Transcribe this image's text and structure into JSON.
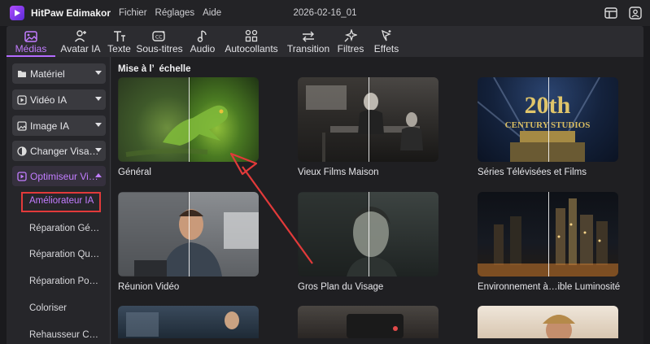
{
  "titlebar": {
    "app_name": "HitPaw Edimakor",
    "menus": [
      "Fichier",
      "Réglages",
      "Aide"
    ],
    "project_title": "2026-02-16_01"
  },
  "toolbar": {
    "tools": [
      {
        "label": "Médias",
        "icon": "media-icon",
        "active": true
      },
      {
        "label": "Avatar IA",
        "icon": "avatar-add-icon"
      },
      {
        "label": "Texte",
        "icon": "text-icon"
      },
      {
        "label": "Sous-titres",
        "icon": "subtitles-icon"
      },
      {
        "label": "Audio",
        "icon": "music-note-icon"
      },
      {
        "label": "Autocollants",
        "icon": "stickers-icon"
      },
      {
        "label": "Transition",
        "icon": "transition-icon"
      },
      {
        "label": "Filtres",
        "icon": "sparkle-filter-icon"
      },
      {
        "label": "Effets",
        "icon": "effects-wand-icon"
      }
    ]
  },
  "sidebar": {
    "categories": [
      {
        "label": "Matériel",
        "icon": "folder-icon"
      },
      {
        "label": "Vidéo IA",
        "icon": "video-ai-icon"
      },
      {
        "label": "Image IA",
        "icon": "image-ai-icon"
      },
      {
        "label": "Changer Visa…",
        "icon": "face-swap-icon"
      },
      {
        "label": "Optimiseur Vi…",
        "icon": "optimizer-icon",
        "expanded": true
      }
    ],
    "subitems": [
      {
        "label": "Améliorateur IA",
        "active": true
      },
      {
        "label": "Réparation Gé…"
      },
      {
        "label": "Réparation Qu…"
      },
      {
        "label": "Réparation Po…"
      },
      {
        "label": "Coloriser"
      },
      {
        "label": "Rehausseur C…"
      }
    ]
  },
  "content": {
    "section_title": "Mise à l’  échelle",
    "cards": [
      {
        "label": "Général"
      },
      {
        "label": "Vieux Films Maison"
      },
      {
        "label": "Séries Télévisées et Films"
      },
      {
        "label": "Réunion Vidéo"
      },
      {
        "label": "Gros Plan du Visage"
      },
      {
        "label": "Environnement à…ible Luminosité"
      }
    ],
    "thumbnail_texts": {
      "studio_logo_top": "20th",
      "studio_logo_bottom": "CENTURY STUDIOS"
    }
  },
  "colors": {
    "accent": "#b36bff",
    "annotation_red": "#e23a3a"
  }
}
